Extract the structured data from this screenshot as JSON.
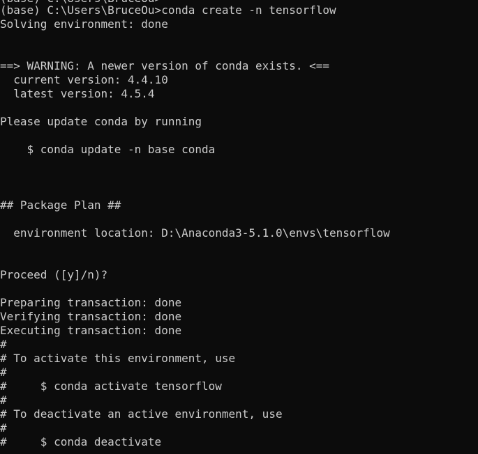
{
  "terminal": {
    "lines": [
      "(base) C:\\Users\\BruceOu>",
      "(base) C:\\Users\\BruceOu>conda create -n tensorflow",
      "Solving environment: done",
      "",
      "",
      "==> WARNING: A newer version of conda exists. <==",
      "  current version: 4.4.10",
      "  latest version: 4.5.4",
      "",
      "Please update conda by running",
      "",
      "    $ conda update -n base conda",
      "",
      "",
      "",
      "## Package Plan ##",
      "",
      "  environment location: D:\\Anaconda3-5.1.0\\envs\\tensorflow",
      "",
      "",
      "Proceed ([y]/n)?",
      "",
      "Preparing transaction: done",
      "Verifying transaction: done",
      "Executing transaction: done",
      "#",
      "# To activate this environment, use",
      "#",
      "#     $ conda activate tensorflow",
      "#",
      "# To deactivate an active environment, use",
      "#",
      "#     $ conda deactivate"
    ]
  }
}
